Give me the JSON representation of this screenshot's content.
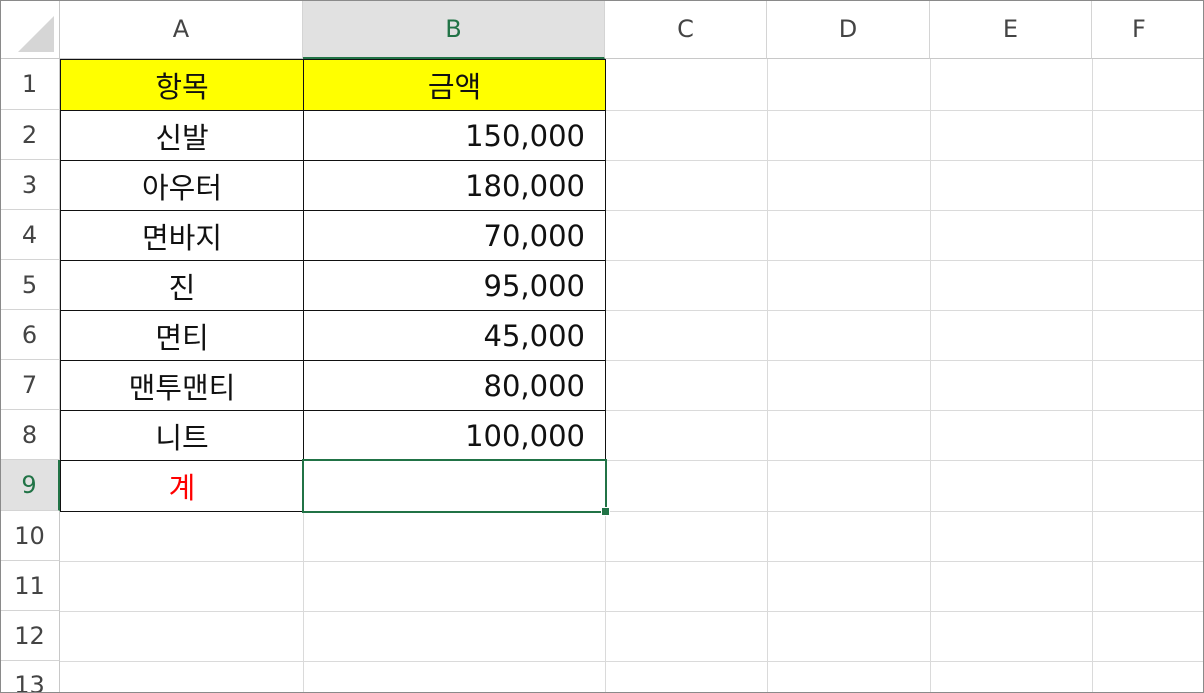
{
  "columns": [
    "A",
    "B",
    "C",
    "D",
    "E",
    "F"
  ],
  "rows": [
    "1",
    "2",
    "3",
    "4",
    "5",
    "6",
    "7",
    "8",
    "9",
    "10",
    "11",
    "12",
    "13"
  ],
  "table": {
    "header": {
      "item": "항목",
      "amount": "금액"
    },
    "items": [
      {
        "item": "신발",
        "amount": "150,000"
      },
      {
        "item": "아우터",
        "amount": "180,000"
      },
      {
        "item": "면바지",
        "amount": "70,000"
      },
      {
        "item": "진",
        "amount": "95,000"
      },
      {
        "item": "면티",
        "amount": "45,000"
      },
      {
        "item": "맨투맨티",
        "amount": "80,000"
      },
      {
        "item": "니트",
        "amount": "100,000"
      }
    ],
    "total": {
      "item": "계",
      "amount": ""
    }
  },
  "selection": {
    "cell": "B9"
  },
  "colors": {
    "header_fill": "#ffff00",
    "total_label": "#ff0000",
    "selection": "#217346"
  }
}
